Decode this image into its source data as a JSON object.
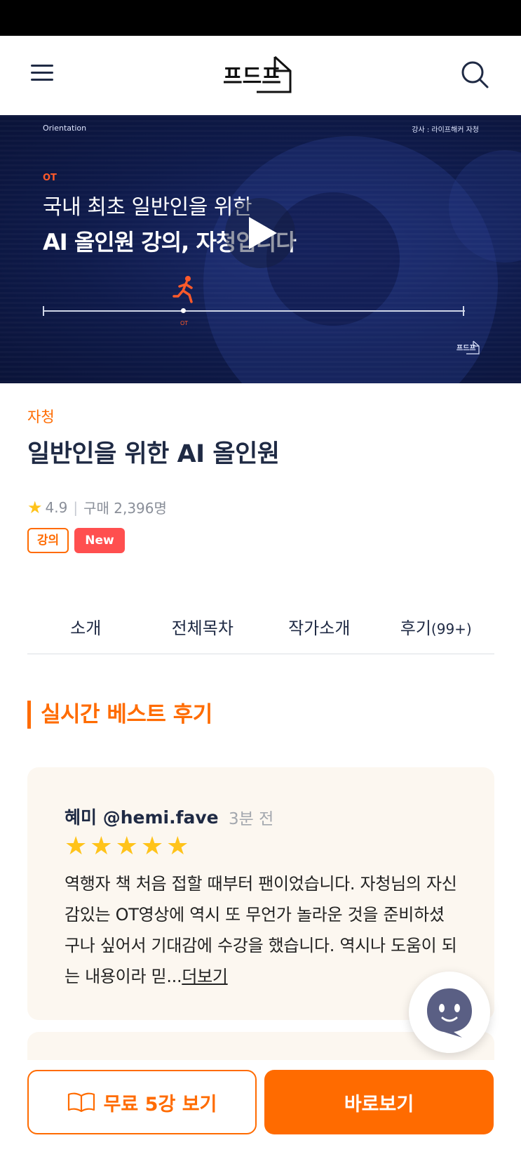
{
  "header": {
    "menu_icon": "hamburger-menu-icon",
    "logo_text": "프드프",
    "search_icon": "search-icon"
  },
  "video": {
    "top_left": "Orientation",
    "top_right": "강사 : 라이프해커 자청",
    "tag": "OT",
    "headline_1": "국내 최초 일반인을 위한",
    "headline_2": "AI 올인원 강의, 자청입니다",
    "timeline_label": "OT",
    "play_icon": "play-icon",
    "logo_text": "프드프"
  },
  "product": {
    "category": "자청",
    "title": "일반인을 위한 AI 올인원",
    "rating": "4.9",
    "purchases": "구매 2,396명",
    "tags": [
      "강의",
      "New"
    ]
  },
  "tabs": [
    {
      "label": "소개",
      "suffix": ""
    },
    {
      "label": "전체목차",
      "suffix": ""
    },
    {
      "label": "작가소개",
      "suffix": ""
    },
    {
      "label": "후기",
      "suffix": "(99+)"
    }
  ],
  "reviews_section": {
    "title": "실시간 베스트 후기",
    "reviews": [
      {
        "author": "혜미 @hemi.fave",
        "time": "3분 전",
        "stars": 5,
        "body": "역행자 책 처음 접할 때부터 팬이었습니다. 자청님의 자신감있는 OT영상에 역시 또 무언가 놀라운 것을 준비하셨구나 싶어서 기대감에 수강을 했습니다. 역시나 도움이 되는 내용이라 믿...",
        "more": "더보기"
      }
    ]
  },
  "bottom_bar": {
    "free_icon": "open-book-icon",
    "free_label": "무료 5강 보기",
    "buy_label": "바로보기"
  },
  "chatbot_icon": "chatbot-ghost-icon",
  "colors": {
    "accent": "#ff6b00",
    "navy": "#1f2a44",
    "new_badge": "#ff4f4f",
    "star": "#ffc31a",
    "review_bg": "#fcf7f0"
  }
}
